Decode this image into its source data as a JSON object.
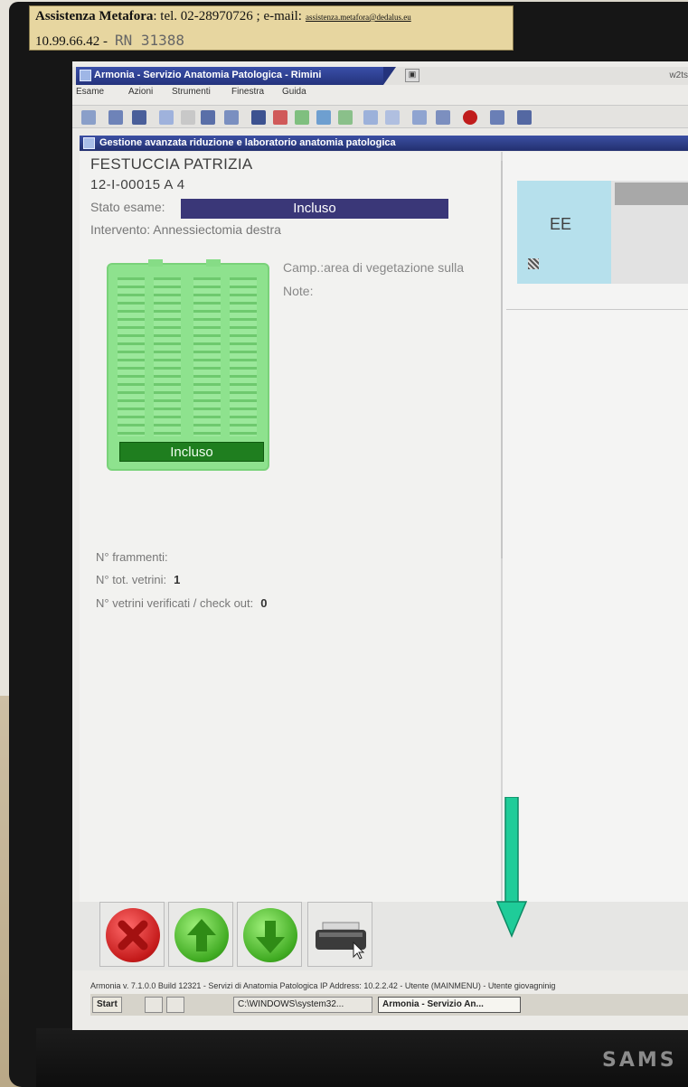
{
  "sticker": {
    "line1_company": "Assistenza Metafora",
    "line1_rest": ": tel. 02-28970726 ; e-mail:",
    "email": "assistenza.metafora@dedalus.eu",
    "line2_ip": "10.99.66.42 -",
    "line2_handwritten": "RN 31388"
  },
  "window": {
    "title": "Armonia - Servizio Anatomia Patologica - Rimini",
    "title_right": "w2ts"
  },
  "menu": [
    "Esame",
    "Azioni",
    "Strumenti",
    "Finestra",
    "Guida"
  ],
  "subwindow_title": "Gestione avanzata riduzione e laboratorio anatomia patologica",
  "patient": {
    "name": "FESTUCCIA PATRIZIA",
    "exam_code": "12-I-00015  A  4",
    "status_label": "Stato esame:",
    "status_value": "Incluso",
    "intervento": "Intervento: Annessiectomia destra"
  },
  "cassette": {
    "label": "Incluso",
    "color": "#8ee28e"
  },
  "sample": {
    "camp": "Camp.:area di vegetazione sulla",
    "note": "Note:"
  },
  "counts": {
    "frammenti_label": "N° frammenti:",
    "vetrini_label": "N° tot. vetrini:",
    "vetrini_value": "1",
    "verificati_label": "N° vetrini verificati / check out:",
    "verificati_value": "0"
  },
  "right_panel": {
    "card_label": "EE"
  },
  "buttons": {
    "cancel_icon": "cancel-x-icon",
    "up_icon": "arrow-up-icon",
    "down_icon": "arrow-down-icon",
    "print_icon": "printer-icon"
  },
  "statusbar": "Armonia v. 7.1.0.0 Build 12321 - Servizi di Anatomia Patologica IP Address: 10.2.2.42 - Utente (MAINMENU) - Utente giovagninig",
  "taskbar": {
    "start": "Start",
    "item1": "C:\\WINDOWS\\system32...",
    "item2": "Armonia - Servizio An..."
  },
  "monitor_brand": "SAMS",
  "colors": {
    "title_blue": "#24337c",
    "status_bar": "#3a3778",
    "cassette_label": "#1f7e1f",
    "annotation_arrow": "#1fcc99"
  }
}
